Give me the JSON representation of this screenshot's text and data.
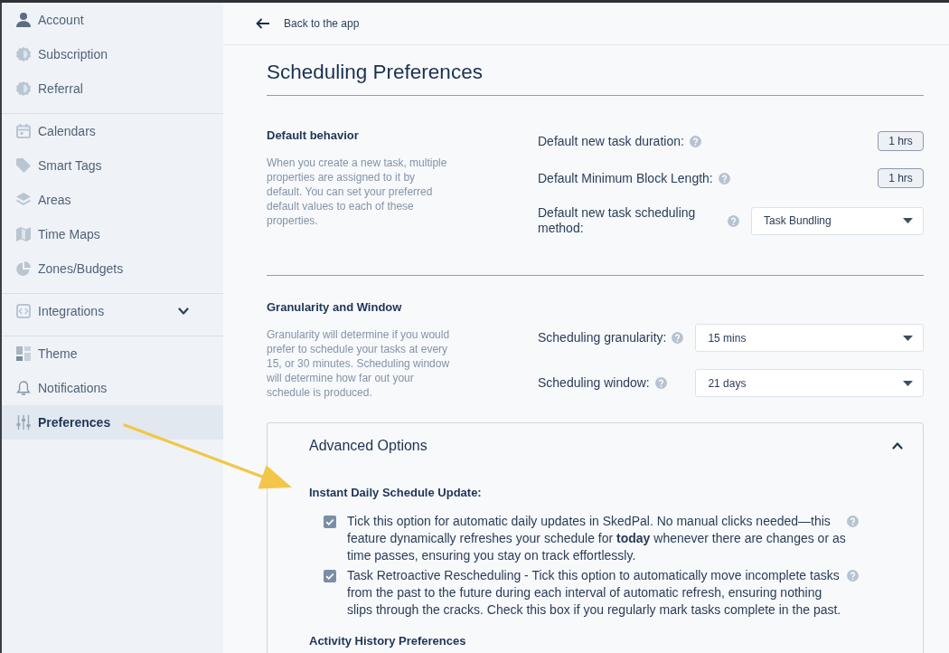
{
  "sidebar": {
    "sections": [
      {
        "items": [
          {
            "label": "Account",
            "selected": false
          },
          {
            "label": "Subscription",
            "selected": false
          },
          {
            "label": "Referral",
            "selected": false
          }
        ]
      },
      {
        "items": [
          {
            "label": "Calendars",
            "selected": false
          },
          {
            "label": "Smart Tags",
            "selected": false
          },
          {
            "label": "Areas",
            "selected": false
          },
          {
            "label": "Time Maps",
            "selected": false
          },
          {
            "label": "Zones/Budgets",
            "selected": false
          }
        ]
      },
      {
        "items": [
          {
            "label": "Integrations",
            "selected": false,
            "expanded": false
          }
        ]
      },
      {
        "items": [
          {
            "label": "Theme",
            "selected": false
          },
          {
            "label": "Notifications",
            "selected": false
          },
          {
            "label": "Preferences",
            "selected": true
          }
        ]
      }
    ]
  },
  "back_link": {
    "label": "Back to the app"
  },
  "title": "Scheduling Preferences",
  "sections": [
    {
      "heading": "Default behavior",
      "description": "When you create a new task, multiple properties are assigned to it by default. You can set your preferred default values to each of these properties.",
      "fields": [
        {
          "kind": "number",
          "label": "Default new task duration:",
          "value": "1 hrs"
        },
        {
          "kind": "number",
          "label": "Default Minimum Block Length:",
          "value": "1 hrs"
        },
        {
          "kind": "select",
          "label": "Default new task scheduling method:",
          "value": "Task Bundling"
        }
      ]
    },
    {
      "heading": "Granularity and Window",
      "description": "Granularity will determine if you would prefer to schedule your tasks at every 15, or 30 minutes. Scheduling window will determine how far out your schedule is produced.",
      "fields": [
        {
          "kind": "select",
          "label": "Scheduling granularity:",
          "value": "15 mins"
        },
        {
          "kind": "select",
          "label": "Scheduling window:",
          "value": "21 days"
        }
      ]
    }
  ],
  "advanced_options": {
    "title": "Advanced Options",
    "expanded": true,
    "groups": [
      {
        "heading": "Instant Daily Schedule Update:",
        "options": [
          {
            "text": "Tick this option for automatic daily updates in SkedPal. No manual clicks needed—this feature dynamically refreshes your schedule for **today** whenever there are changes or as time passes, ensuring you stay on track effortlessly.",
            "checked": true
          },
          {
            "text": "Task Retroactive Rescheduling - Tick this option to automatically move incomplete tasks from the past to the future during each interval of automatic refresh, ensuring nothing slips through the cracks. Check this box if you regularly mark tasks complete in the past.",
            "checked": true
          }
        ]
      },
      {
        "heading": "Activity History Preferences"
      }
    ]
  }
}
